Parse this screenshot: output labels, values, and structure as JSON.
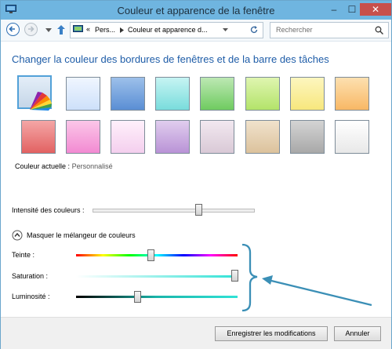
{
  "window": {
    "title": "Couleur et apparence de la fenêtre"
  },
  "controls": {
    "minimize": "–",
    "maximize": "☐",
    "close": "✕"
  },
  "nav": {
    "breadcrumb_root": "«",
    "crumb1": "Pers...",
    "crumb2": "Couleur et apparence d...",
    "search_placeholder": "Rechercher"
  },
  "main": {
    "heading": "Changer la couleur des bordures de fenêtres et de la barre des tâches",
    "current_label": "Couleur actuelle :",
    "current_value": "Personnalisé",
    "intensity_label": "Intensité des couleurs :",
    "mixer_toggle_label": "Masquer le mélangeur de couleurs",
    "hue_label": "Teinte :",
    "saturation_label": "Saturation :",
    "luminosity_label": "Luminosité :"
  },
  "footer": {
    "save": "Enregistrer les modifications",
    "cancel": "Annuler"
  }
}
